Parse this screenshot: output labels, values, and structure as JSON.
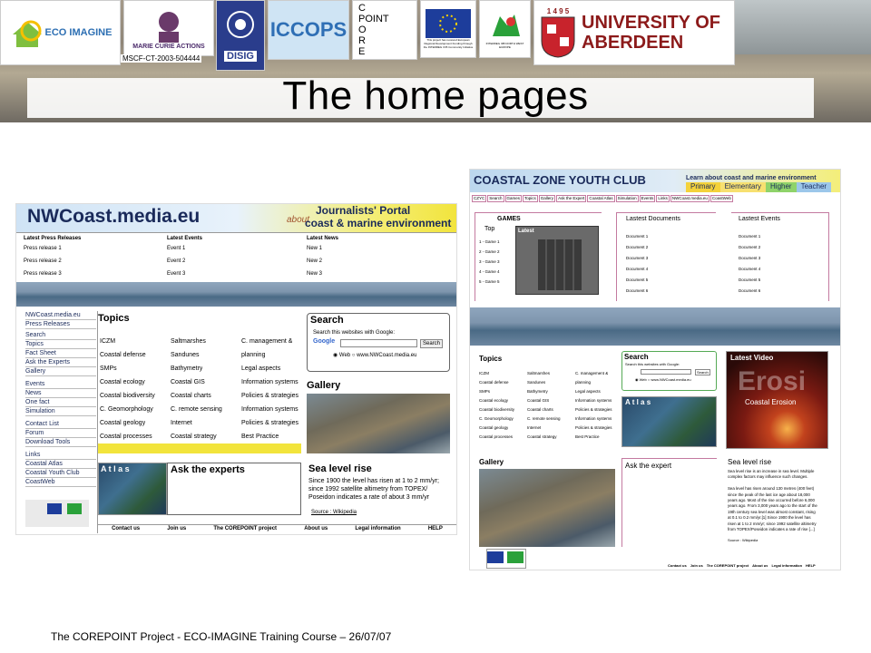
{
  "header": {
    "eco_imagine": "ECO IMAGINE",
    "marie_curie": "MARIE CURIE ACTIONS",
    "grant_code": "MSCF-CT-2003-504444",
    "iccops": "ICCOPS",
    "disig": "DISIG",
    "corepoint_letters": [
      "C",
      "POINT",
      "O",
      "R",
      "E"
    ],
    "eu_text": "This project has received European Regional Development Funding through the INTERREG III B Community Initiative",
    "interreg": "INTERREG IIIB NORTH WEST EUROPE",
    "aberdeen_year": "1 4 9 5",
    "aberdeen": "UNIVERSITY OF ABERDEEN"
  },
  "title": "The home pages",
  "footer": "The COREPOINT  Project - ECO-IMAGINE  Training Course – 26/07/07",
  "left_site": {
    "brand": "NWCoast.media.eu",
    "about": "about",
    "portal": "Journalists' Portal",
    "portal_sub": "coast & marine environment",
    "columns": [
      {
        "head": "Latest Press Releases",
        "items": [
          "Press release 1",
          "Press release 2",
          "Press release 3"
        ]
      },
      {
        "head": "Latest Events",
        "items": [
          "Event 1",
          "Event 2",
          "Event 3"
        ]
      },
      {
        "head": "Latest News",
        "items": [
          "New 1",
          "New 2",
          "New 3"
        ]
      }
    ],
    "nav": [
      "NWCoast.media.eu",
      "Press Releases",
      "Search",
      "Topics",
      "Fact Sheet",
      "Ask the Experts",
      "Gallery",
      "Events",
      "News",
      "One fact",
      "Simulation",
      "Contact List",
      "Forum",
      "Download Tools",
      "Links",
      "Coastal Atlas",
      "Coastal Youth Club",
      "CoastWeb"
    ],
    "topics_head": "Topics",
    "topics": [
      [
        "ICZM",
        "Saltmarshes",
        "C. management &"
      ],
      [
        "Coastal defense",
        "Sandunes",
        "planning"
      ],
      [
        "SMPs",
        "Bathymetry",
        "Legal aspects"
      ],
      [
        "Coastal ecology",
        "Coastal GIS",
        "Information systems"
      ],
      [
        "Coastal biodiversity",
        "Coastal charts",
        "Policies & strategies"
      ],
      [
        "C. Geomorphology",
        "C. remote sensing",
        "Information systems"
      ],
      [
        "Coastal geology",
        "Internet",
        "Policies & strategies"
      ],
      [
        "Coastal processes",
        "Coastal strategy",
        "Best Practice"
      ]
    ],
    "search_head": "Search",
    "search_text": "Search this websites with Google:",
    "google": "Google",
    "search_btn": "Search",
    "search_opts": "◉ Web  ○ www.NWCoast.media.eu",
    "gallery_head": "Gallery",
    "atlas": "A t l a s",
    "ask": "Ask the experts",
    "sea_head": "Sea level rise",
    "sea_text": [
      "Since 1900 the level has risen at 1 to 2 mm/yr;",
      "since 1992 satellite altimetry from TOPEX/",
      "Poseidon indicates a rate of about 3 mm/yr"
    ],
    "source": "Source : Wikipedia",
    "footer_links": [
      "Contact us",
      "Join us",
      "The COREPOINT project",
      "About us",
      "Legal information",
      "HELP"
    ]
  },
  "right_site": {
    "brand": "COASTAL ZONE YOUTH CLUB",
    "learn": "Learn about coast and marine environment",
    "levels": [
      "Primary",
      "Elementary",
      "Higher",
      "Teacher"
    ],
    "nav": [
      "CZYC",
      "Search",
      "Games",
      "Topics",
      "Gallery",
      "Ask the Expert",
      "Coastal Atlas",
      "Simulation",
      "Events",
      "Links",
      "NWCoast.media.eu",
      "CoastWeb"
    ],
    "games_head": "GAMES",
    "games_top": "Top",
    "games": [
      "1 - Game 1",
      "2 - Game 2",
      "3 - Game 3",
      "4 - Game 4",
      "5 - Game 5"
    ],
    "latest": "Latest",
    "docs_head": "Lastest Documents",
    "docs": [
      "Document 1",
      "Document 2",
      "Document 3",
      "Document 4",
      "Document 5",
      "Document 6"
    ],
    "events_head": "Lastest Events",
    "events": [
      "Document 1",
      "Document 2",
      "Document 3",
      "Document 4",
      "Document 5",
      "Document 6"
    ],
    "topics_head": "Topics",
    "topics": [
      [
        "ICZM",
        "Saltmarshes",
        "C. management &"
      ],
      [
        "Coastal defense",
        "Sandunes",
        "planning"
      ],
      [
        "SMPs",
        "Bathymetry",
        "Legal aspects"
      ],
      [
        "Coastal ecology",
        "Coastal GIS",
        "Information systems"
      ],
      [
        "Coastal biodiversity",
        "Coastal charts",
        "Policies & strategies"
      ],
      [
        "C. Geomorphology",
        "C. remote sensing",
        "Information systems"
      ],
      [
        "Coastal geology",
        "Internet",
        "Policies & strategies"
      ],
      [
        "Coastal processes",
        "Coastal strategy",
        "Best Practice"
      ]
    ],
    "search_head": "Search",
    "search_text": "Search this websites with Google:",
    "search_btn": "Search",
    "search_opts": "◉ Web  ○ www.NWCoast.media.eu",
    "atlas": "A t l a s",
    "video_head": "Latest Video",
    "video_big": "Erosi",
    "video_sub": "Coastal Erosion",
    "gallery_head": "Gallery",
    "ask": "Ask the expert",
    "sea_head": "Sea level rise",
    "sea_text": [
      "Sea level rise is an increase in sea level. Multiple",
      "complex factors may influence such changes.",
      "",
      "Sea level has risen around 130 metres (400 feet)",
      "since the peak of the last ice age about 18,000",
      "years ago. Most of the rise occurred before 6,000",
      "years ago. From 3,000 years ago to the start of the",
      "19th century sea level was almost constant, rising",
      "at 0.1 to 0.2 mm/yr.[1] Since 1900 the level has",
      "risen at 1 to 2 mm/yr; since 1992 satellite altimetry",
      "from TOPEX/Poseidon indicates a rate of rise [...]"
    ],
    "source": "Source : Wikipedia",
    "footer_links": [
      "Contact us",
      "Join us",
      "The COREPOINT project",
      "About us",
      "Legal information",
      "HELP"
    ]
  }
}
